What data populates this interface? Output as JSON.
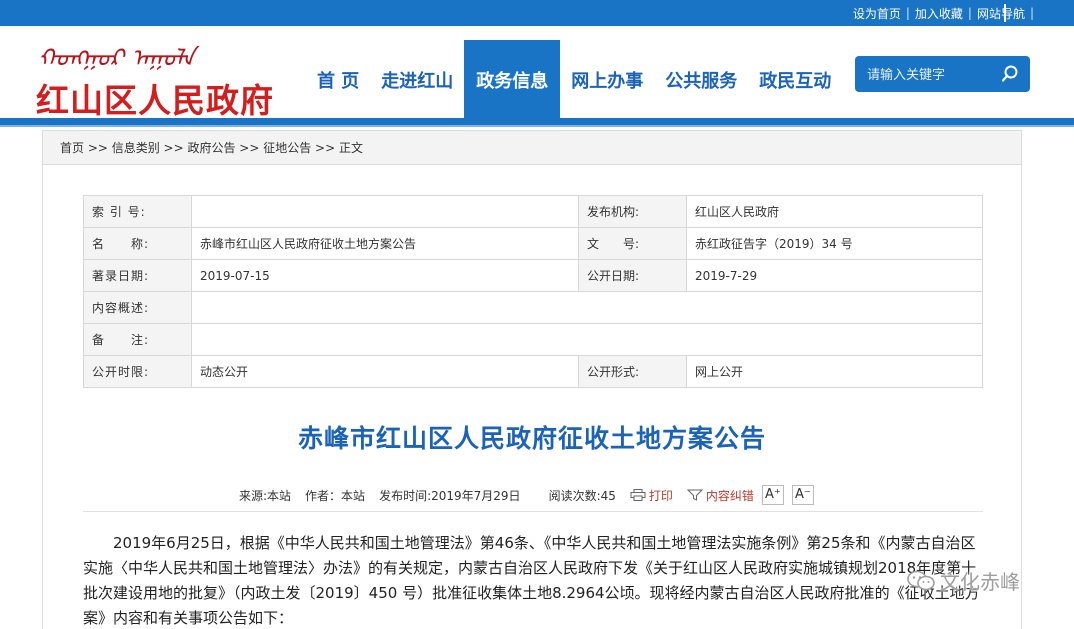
{
  "topbar": {
    "links": [
      "设为首页",
      "加入收藏",
      "网站导航"
    ]
  },
  "header": {
    "mongol_script": "ᠬᠣᠩᠭᠣᠷ ᠠᠭᠤᠯᠠ",
    "site_title": "红山区人民政府"
  },
  "nav": {
    "items": [
      "首 页",
      "走进红山",
      "政务信息",
      "网上办事",
      "公共服务",
      "政民互动"
    ],
    "active_index": 2
  },
  "search": {
    "placeholder": "请输入关键字"
  },
  "breadcrumb": {
    "text": "首页 >> 信息类别 >> 政府公告 >> 征地公告 >> 正文"
  },
  "meta": {
    "rows": [
      {
        "l1": "索 引 号:",
        "v1": "",
        "l2": "发布机构:",
        "v2": "红山区人民政府"
      },
      {
        "l1": "名　　称:",
        "v1": "赤峰市红山区人民政府征收土地方案公告",
        "l2": "文　　号:",
        "v2": "赤红政征告字（2019）34 号"
      },
      {
        "l1": "著录日期:",
        "v1": "2019-07-15",
        "l2": "公开日期:",
        "v2": "2019-7-29"
      },
      {
        "l1": "内容概述:",
        "v1": ""
      },
      {
        "l1": "备　　注:",
        "v1": ""
      },
      {
        "l1": "公开时限:",
        "v1": "动态公开",
        "l2": "公开形式:",
        "v2": "网上公开"
      }
    ]
  },
  "article": {
    "title": "赤峰市红山区人民政府征收土地方案公告",
    "source": "来源:本站",
    "author": "作者：本站",
    "published": "发布时间:2019年7月29日",
    "views": "阅读次数:45",
    "print_label": "打印",
    "report_label": "内容纠错",
    "font_up": "A⁺",
    "font_down": "A⁻",
    "body": "2019年6月25日，根据《中华人民共和国土地管理法》第46条、《中华人民共和国土地管理法实施条例》第25条和《内蒙古自治区实施〈中华人民共和国土地管理法〉办法》的有关规定，内蒙古自治区人民政府下发《关于红山区人民政府实施城镇规划2018年度第十批次建设用地的批复》（内政土发〔2019〕450 号）批准征收集体土地8.2964公顷。现将经内蒙古自治区人民政府批准的《征收土地方案》内容和有关事项公告如下："
  },
  "watermark": {
    "text": "文化赤峰"
  },
  "colors": {
    "primary_blue": "#1a74c6",
    "title_red": "#d41e1e",
    "nav_text": "#1b63b8"
  }
}
